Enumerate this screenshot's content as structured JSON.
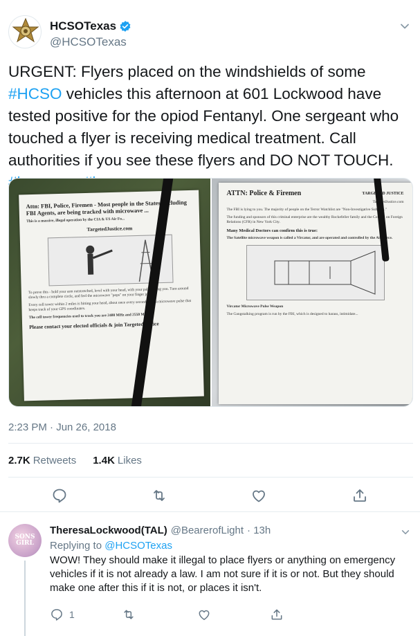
{
  "tweet": {
    "author_name": "HCSOTexas",
    "author_handle": "@HCSOTexas",
    "text_parts": [
      {
        "t": "URGENT: Flyers placed on the windshields of some ",
        "tag": false
      },
      {
        "t": "#HCSO",
        "tag": true
      },
      {
        "t": " vehicles this afternoon at 601 Lockwood have tested positive for the opiod Fentanyl. One sergeant who touched a flyer is receiving medical treatment. Call authorities if you see these flyers and DO NOT TOUCH. ",
        "tag": false
      },
      {
        "t": "#hounews",
        "tag": true
      },
      {
        "t": " ",
        "tag": false
      },
      {
        "t": "#lesm",
        "tag": true
      }
    ],
    "timestamp": "2:23 PM · Jun 26, 2018",
    "retweets_count": "2.7K",
    "retweets_label": "Retweets",
    "likes_count": "1.4K",
    "likes_label": "Likes"
  },
  "media": {
    "left_flyer": {
      "heading": "Attn: FBI, Police, Firemen - Most people in the States, including FBI Agents, are being tracked with microwave ...",
      "sub": "This is a massive, illegal operation by the CIA & US Air Fo...",
      "site": "TargetedJustice.com",
      "body1": "To prove this - hold your arm outstretched, level with your head, with your palm facing you. Turn around slowly thru a complete circle, and feel the microwave \"pops\" on your finger joints.",
      "body2": "Every cell tower within 2 miles is hitting your head, about once every second, with a microwave pulse that keeps track of your GPS coordinates.",
      "body3": "The cell tower frequencies used to track you are 2400 MHz and 2550 MHz.",
      "footer": "Please contact your elected officials & join TargetedJustice"
    },
    "right_flyer": {
      "heading": "ATTN: Police & Firemen",
      "brand": "TARGETED JUSTICE",
      "site": "TargetedJustice.com",
      "body1": "The FBI is lying to you. The majority of people on the Terror Watchlist are \"Non-Investigative Subjects.\"",
      "body2": "The funding and sponsors of this criminal enterprise are the wealthy Rockefeller family and the Council on Foreign Relations (CFR) in New York City.",
      "body3": "Many Medical Doctors can confirm this is true:",
      "body4": "The Satellite microwave weapon is called a Vircator, and are operated and controlled by the Air Force.",
      "caption": "Vircator Microwave Pulse Weapon",
      "footer": "The Gangstalking program is run by the FBI, which is designed to harass, intimidate..."
    }
  },
  "reply": {
    "author_name": "TheresaLockwood(TAL)",
    "author_handle": "@BearerofLight",
    "time": "· 13h",
    "replying_prefix": "Replying to",
    "replying_to": "@HCSOTexas",
    "text": "WOW! They should make it illegal to place flyers or anything on emergency vehicles if it is not already a law. I am not sure if it is or not. But they should make one after this if it is not, or places it isn't.",
    "avatar_text": "SONS GIRL",
    "reply_count": "1"
  },
  "colors": {
    "link": "#1da1f2",
    "secondary": "#657786",
    "primary": "#14171a",
    "divider": "#e6ecf0"
  },
  "icons": [
    "sheriff-badge-icon",
    "verified-badge-icon",
    "chevron-down-icon",
    "reply-icon",
    "retweet-icon",
    "like-icon",
    "share-icon"
  ]
}
